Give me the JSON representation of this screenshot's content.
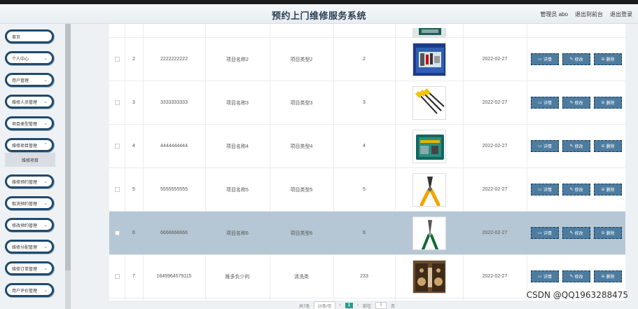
{
  "header": {
    "title": "预约上门维修服务系统",
    "user": "管理员 abo",
    "back_label": "退出到前台",
    "logout_label": "退出登录"
  },
  "sidebar": {
    "items": [
      {
        "label": "首页",
        "expandable": false
      },
      {
        "label": "个人中心",
        "expandable": true
      },
      {
        "label": "用户管理",
        "expandable": true
      },
      {
        "label": "维修人员管理",
        "expandable": true
      },
      {
        "label": "项目类型管理",
        "expandable": true
      },
      {
        "label": "维修项目管理",
        "expandable": true
      },
      {
        "label": "维修预约管理",
        "expandable": true
      },
      {
        "label": "取消预约管理",
        "expandable": true
      },
      {
        "label": "修改预约管理",
        "expandable": true
      },
      {
        "label": "维修分配管理",
        "expandable": true
      },
      {
        "label": "维修订单管理",
        "expandable": true
      },
      {
        "label": "用户评价管理",
        "expandable": true
      }
    ],
    "submenu": {
      "label": "维修项目"
    }
  },
  "table": {
    "rows": [
      {
        "index": "2",
        "code": "2222222222",
        "name": "项目名称2",
        "type": "项目类型2",
        "count": "2",
        "date": "2022-02-27",
        "image": "toolbox-blue-icon",
        "selected": false
      },
      {
        "index": "3",
        "code": "3333333333",
        "name": "项目名称3",
        "type": "项目类型3",
        "count": "3",
        "date": "2022-02-27",
        "image": "screwdriver-icon",
        "selected": false
      },
      {
        "index": "4",
        "code": "4444444444",
        "name": "项目名称4",
        "type": "项目类型4",
        "count": "4",
        "date": "2022-02-27",
        "image": "toolcase-green-icon",
        "selected": false
      },
      {
        "index": "5",
        "code": "5555555555",
        "name": "项目名称5",
        "type": "项目类型5",
        "count": "5",
        "date": "2022-02-27",
        "image": "pliers-icon",
        "selected": false
      },
      {
        "index": "6",
        "code": "6666666666",
        "name": "项目名称6",
        "type": "项目类型6",
        "count": "6",
        "date": "2022-02-27",
        "image": "wire-stripper-icon",
        "selected": true
      },
      {
        "index": "7",
        "code": "1645964579115",
        "name": "推多负少的",
        "type": "清洗类",
        "count": "233",
        "date": "2022-02-27",
        "image": "speaker-cabinet-icon",
        "selected": false
      }
    ],
    "actions": {
      "detail_label": "详情",
      "edit_label": "修改",
      "delete_label": "删除",
      "detail_icon": "detail-icon",
      "edit_icon": "edit-icon",
      "delete_icon": "delete-icon"
    }
  },
  "pagination": {
    "total_label": "共7条",
    "page_size_label": "10条/页",
    "prev_label": "‹",
    "current_page": "1",
    "next_label": "›",
    "goto_label": "前往",
    "goto_value": "1",
    "page_unit": "页"
  },
  "watermark": "CSDN @QQ1963288475",
  "colors": {
    "accent": "#1f4a6d",
    "button": "#4d7c9f",
    "selected_row": "#b5c7d4",
    "page_active": "#2a9d8f"
  }
}
